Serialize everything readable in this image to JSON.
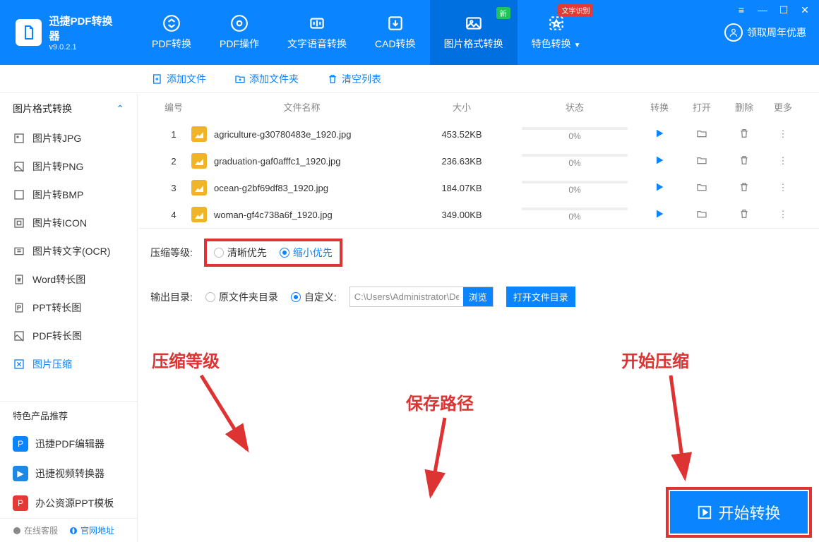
{
  "brand": {
    "title": "迅捷PDF转换器",
    "version": "v9.0.2.1"
  },
  "navs": [
    {
      "label": "PDF转换"
    },
    {
      "label": "PDF操作"
    },
    {
      "label": "文字语音转换"
    },
    {
      "label": "CAD转换"
    },
    {
      "label": "图片格式转换",
      "active": true,
      "badge": "新"
    },
    {
      "label": "特色转换",
      "badge": "文字识别",
      "badge_red": true,
      "caret": true
    }
  ],
  "claim": "领取周年优惠",
  "toolbar": {
    "add_file": "添加文件",
    "add_folder": "添加文件夹",
    "clear": "清空列表"
  },
  "sidebar": {
    "group_title": "图片格式转换",
    "items": [
      {
        "label": "图片转JPG"
      },
      {
        "label": "图片转PNG"
      },
      {
        "label": "图片转BMP"
      },
      {
        "label": "图片转ICON"
      },
      {
        "label": "图片转文字(OCR)"
      },
      {
        "label": "Word转长图"
      },
      {
        "label": "PPT转长图"
      },
      {
        "label": "PDF转长图"
      },
      {
        "label": "图片压缩",
        "active": true
      }
    ],
    "section_title": "特色产品推荐",
    "promos": [
      {
        "label": "迅捷PDF编辑器",
        "color": "#0a84ff"
      },
      {
        "label": "迅捷视频转换器",
        "color": "#1e88e5"
      },
      {
        "label": "办公资源PPT模板",
        "color": "#e53935"
      }
    ],
    "footer": {
      "service": "在线客服",
      "site": "官网地址"
    }
  },
  "table": {
    "headers": {
      "idx": "编号",
      "name": "文件名称",
      "size": "大小",
      "status": "状态",
      "conv": "转换",
      "open": "打开",
      "del": "删除",
      "more": "更多"
    },
    "rows": [
      {
        "idx": "1",
        "name": "agriculture-g30780483e_1920.jpg",
        "size": "453.52KB",
        "status": "0%"
      },
      {
        "idx": "2",
        "name": "graduation-gaf0afffc1_1920.jpg",
        "size": "236.63KB",
        "status": "0%"
      },
      {
        "idx": "3",
        "name": "ocean-g2bf69df83_1920.jpg",
        "size": "184.07KB",
        "status": "0%"
      },
      {
        "idx": "4",
        "name": "woman-gf4c738a6f_1920.jpg",
        "size": "349.00KB",
        "status": "0%"
      }
    ]
  },
  "options": {
    "level_label": "压缩等级:",
    "level_clear": "清晰优先",
    "level_small": "缩小优先",
    "out_label": "输出目录:",
    "out_original": "原文件夹目录",
    "out_custom": "自定义:",
    "path": "C:\\Users\\Administrator\\Des",
    "browse": "浏览",
    "open_dir": "打开文件目录"
  },
  "start_label": "开始转换",
  "annotations": {
    "level": "压缩等级",
    "path": "保存路径",
    "start": "开始压缩"
  }
}
